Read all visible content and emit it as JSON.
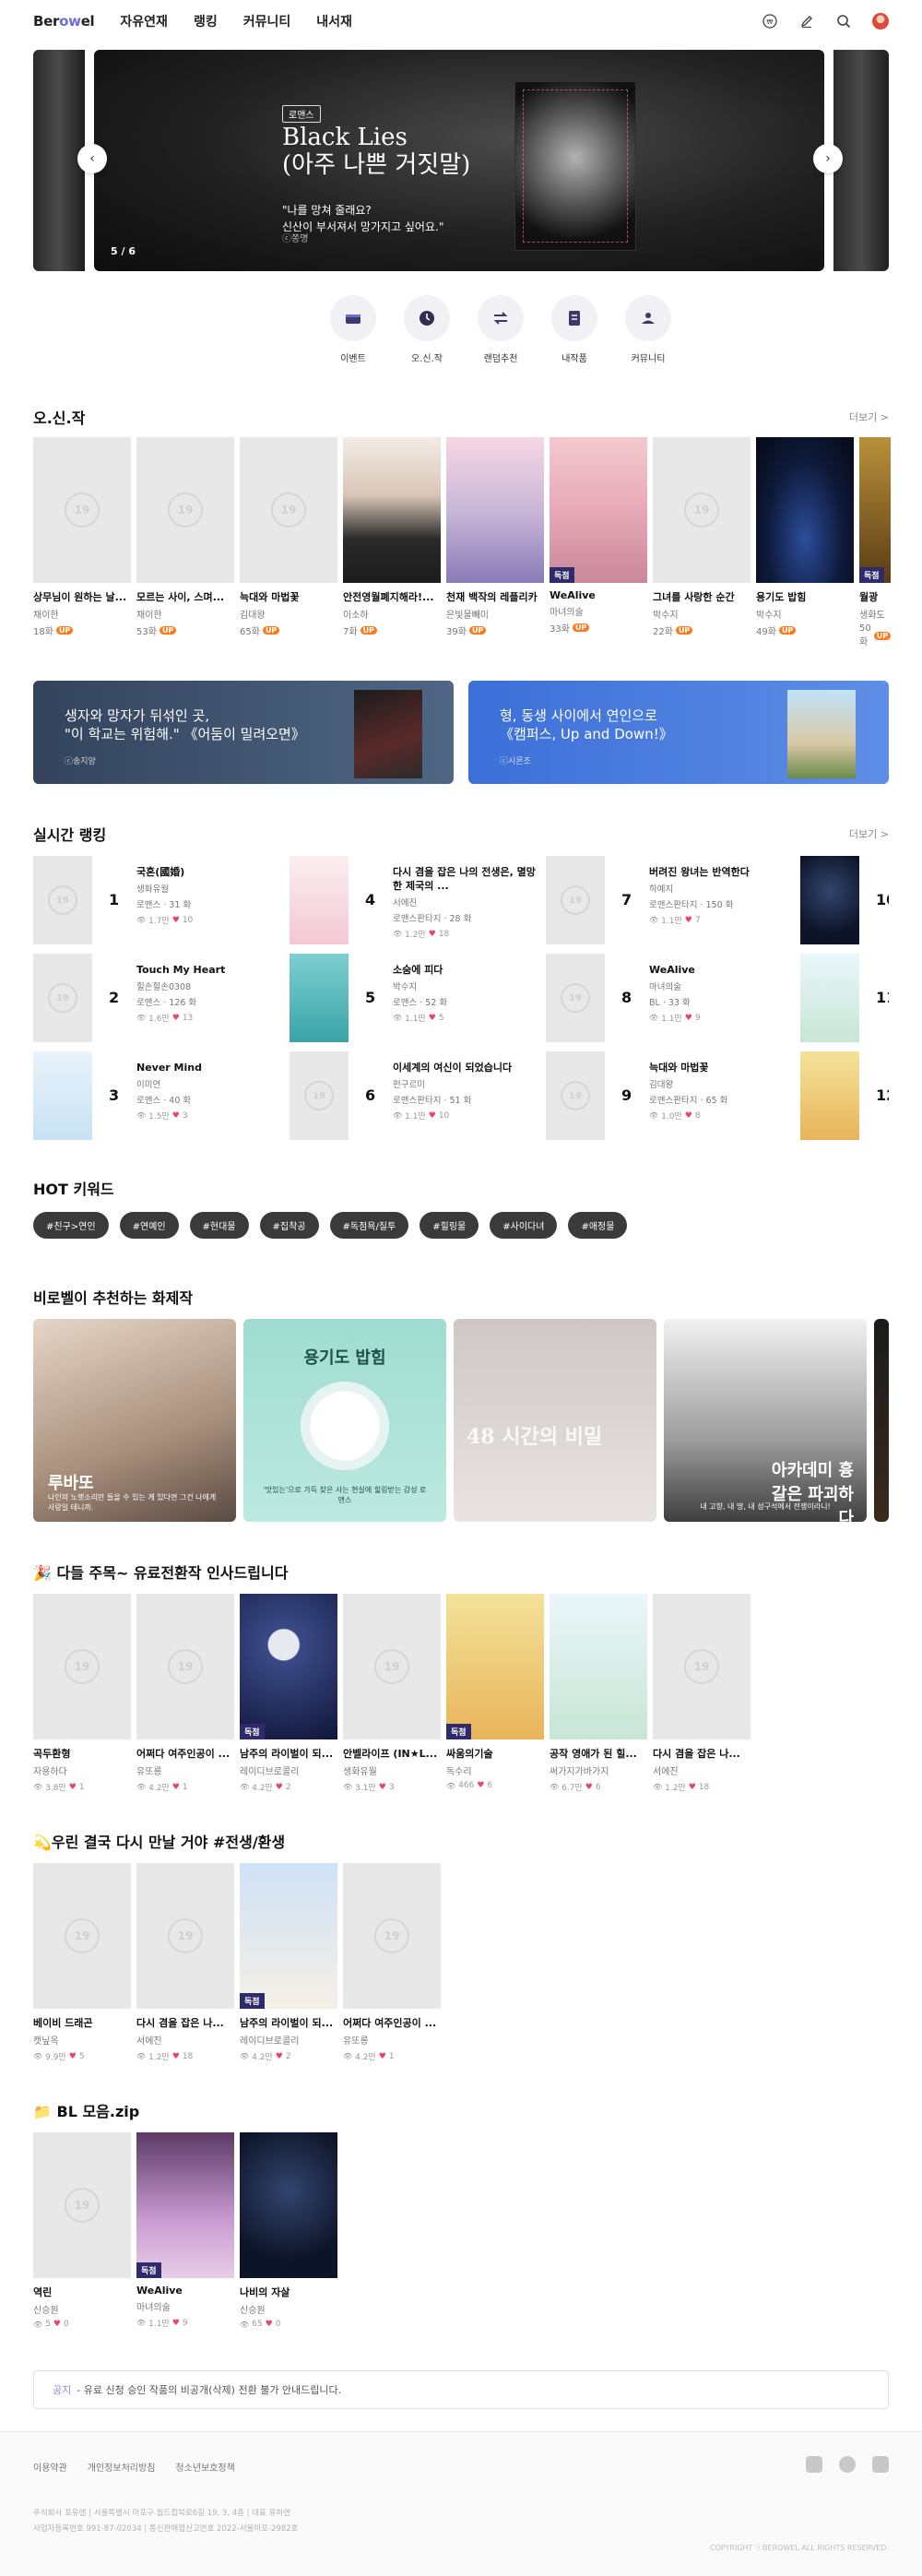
{
  "header": {
    "logo_text": "Berowel",
    "nav": [
      "자유연재",
      "랭킹",
      "커뮤니티",
      "내서재"
    ],
    "icons": [
      "coin-icon",
      "pen-icon",
      "search-icon",
      "avatar"
    ]
  },
  "banner": {
    "tag": "로맨스",
    "title_line1": "Black Lies",
    "title_line2": "(아주 나쁜 거짓말)",
    "copy_line1": "\"나를 망쳐 줄래요?",
    "copy_line2": "신산이 부서져서 망가지고 싶어요.\"",
    "credit": "ⓒ쫑명",
    "page": "5 / 6"
  },
  "quick_menu": [
    {
      "label": "이벤트",
      "icon": "event-icon"
    },
    {
      "label": "오.신.작",
      "icon": "clock-icon"
    },
    {
      "label": "랜덤추천",
      "icon": "shuffle-icon"
    },
    {
      "label": "내작품",
      "icon": "my-works-icon"
    },
    {
      "label": "커뮤니티",
      "icon": "community-icon"
    }
  ],
  "new_works": {
    "title": "오.신.작",
    "more": "더보기 >",
    "items": [
      {
        "title": "상무님이 원하는 날...",
        "author": "채이한",
        "episodes": "18화",
        "cover": "age19"
      },
      {
        "title": "모르는 사이, 스며...",
        "author": "채이한",
        "episodes": "53화",
        "cover": "age19"
      },
      {
        "title": "늑대와 마법꽃",
        "author": "김대왕",
        "episodes": "65화",
        "cover": "age19"
      },
      {
        "title": "안전영월폐지해라!...",
        "author": "이소하",
        "episodes": "7화",
        "cover": "man"
      },
      {
        "title": "천재 백작의 레플리카",
        "author": "은빛물빼미",
        "episodes": "39화",
        "cover": "couple"
      },
      {
        "title": "WeAlive",
        "author": "마녀의술",
        "episodes": "33화",
        "cover": "pink",
        "badge": "독점"
      },
      {
        "title": "그녀를 사랑한 순간",
        "author": "박수지",
        "episodes": "22화",
        "cover": "age19"
      },
      {
        "title": "용기도 밥힘",
        "author": "박수지",
        "episodes": "49화",
        "cover": "night"
      },
      {
        "title": "월광",
        "author": "생화도",
        "episodes": "50화",
        "cover": "gold",
        "badge": "독점"
      }
    ],
    "up_label": "UP"
  },
  "promos": [
    {
      "title_line1": "생자와 망자가 뒤섞인 곳,",
      "title_line2": "\"이 학교는 위험해.\" 《어둠이 밀려오면》",
      "credit": "ⓒ송지양"
    },
    {
      "title_line1": "형, 동생 사이에서 연인으로",
      "title_line2": "《캠퍼스, Up and Down!》",
      "credit": "ⓒ시몬조"
    }
  ],
  "ranking": {
    "title": "실시간 랭킹",
    "more": "더보기 >",
    "items": [
      {
        "rank": "1",
        "title": "국혼(國婚)",
        "author": "생화유월",
        "genre": "로맨스 · 31 화",
        "views": "1.7만",
        "likes": "10",
        "cover": "age19"
      },
      {
        "rank": "2",
        "title": "Touch My Heart",
        "author": "힐손힐손0308",
        "genre": "로맨스 · 126 화",
        "views": "1.6만",
        "likes": "13",
        "cover": "age19"
      },
      {
        "rank": "3",
        "title": "Never Mind",
        "author": "이미연",
        "genre": "로맨스 · 40 화",
        "views": "1.5만",
        "likes": "3",
        "cover": "lightblue"
      },
      {
        "rank": "4",
        "title": "다시 겸을 잡은 나의 전생은, 멸망한 제국의 ...",
        "author": "서에진",
        "genre": "로맨스판타지 · 28 화",
        "views": "1.2만",
        "likes": "18",
        "cover": "pinkwhite"
      },
      {
        "rank": "5",
        "title": "소숨에 피다",
        "author": "박수지",
        "genre": "로맨스 · 52 화",
        "views": "1.1만",
        "likes": "5",
        "cover": "teal"
      },
      {
        "rank": "6",
        "title": "이세계의 여신이 되었습니다",
        "author": "펀구르미",
        "genre": "로맨스판타지 · 51 화",
        "views": "1.1만",
        "likes": "10",
        "cover": "age19"
      },
      {
        "rank": "7",
        "title": "버려진 왕녀는 반역한다",
        "author": "하예지",
        "genre": "로맨스판타지 · 150 화",
        "views": "1.1만",
        "likes": "7",
        "cover": "age19"
      },
      {
        "rank": "8",
        "title": "WeAlive",
        "author": "마녀의술",
        "genre": "BL · 33 화",
        "views": "1.1만",
        "likes": "9",
        "cover": "age19"
      },
      {
        "rank": "9",
        "title": "늑대와 마법꽃",
        "author": "김대왕",
        "genre": "로맨스판타지 · 65 화",
        "views": "1.0만",
        "likes": "8",
        "cover": "age19"
      }
    ],
    "peek_numbers": [
      "10",
      "11",
      "12"
    ]
  },
  "hot_keywords": {
    "title": "HOT 키워드",
    "items": [
      "#친구>연인",
      "#연예인",
      "#현대물",
      "#집착공",
      "#독점욕/질투",
      "#힐링물",
      "#사이다녀",
      "#애정물"
    ]
  },
  "featured": {
    "title": "비로벨이 추천하는 화제작",
    "items": [
      {
        "name": "루바또",
        "sub": "나인의 노랫소리만 들을 수 있는 게 있다면 그건 나에게 사랑일 테니까.",
        "style": "man-portrait"
      },
      {
        "name": "용기도 밥힘",
        "sub": "'맛있는'으로 가득 찾은 사는 현실에 힐링받는 감성 로맨스",
        "style": "plate"
      },
      {
        "name": "48 시간의 비밀",
        "sub": "",
        "style": "woman"
      },
      {
        "name": "아카데미 흉갈은 파괴하다",
        "sub": "내 고향, 내 땅, 내 성구석에서 전쟁이라니!",
        "style": "castle"
      }
    ]
  },
  "paid": {
    "title": "🎉 다들 주목~ 유료전환작 인사드립니다",
    "items": [
      {
        "title": "곡두환형",
        "author": "자용하다",
        "views": "3.8만",
        "likes": "1",
        "cover": "age19"
      },
      {
        "title": "어쩌다 여주인공이 ...",
        "author": "유또롱",
        "views": "4.2만",
        "likes": "1",
        "cover": "age19"
      },
      {
        "title": "남주의 라이벌이 되...",
        "author": "레이디브로콜리",
        "views": "4.2만",
        "likes": "2",
        "cover": "moon",
        "badge": "독점"
      },
      {
        "title": "안벨라이프 (IN★L...",
        "author": "생화유월",
        "views": "3.1만",
        "likes": "3",
        "cover": "age19"
      },
      {
        "title": "싸움의기술",
        "author": "독수리",
        "views": "466",
        "likes": "6",
        "cover": "yellow",
        "badge": "독점"
      },
      {
        "title": "공작 영애가 된 힐...",
        "author": "써가지가바가지",
        "views": "6.7만",
        "likes": "6",
        "cover": "sky"
      },
      {
        "title": "다시 겸을 잡은 나...",
        "author": "서에진",
        "views": "1.2만",
        "likes": "18",
        "cover": "age19"
      }
    ]
  },
  "reincarnation": {
    "title": "💫우린 결국 다시 만날 거야 #전생/환생",
    "items": [
      {
        "title": "베이비 드래곤",
        "author": "캣닢옥",
        "views": "9.9만",
        "likes": "5",
        "cover": "age19"
      },
      {
        "title": "다시 겸을 잡은 나...",
        "author": "서에진",
        "views": "1.2만",
        "likes": "18",
        "cover": "age19"
      },
      {
        "title": "남주의 라이벌이 되...",
        "author": "레이디브로콜리",
        "views": "4.2만",
        "likes": "2",
        "cover": "gukhon",
        "badge": "독점"
      },
      {
        "title": "어쩌다 여주인공이 ...",
        "author": "유또롱",
        "views": "4.2만",
        "likes": "1",
        "cover": "age19"
      }
    ]
  },
  "bl": {
    "title": "📁 BL 모음.zip",
    "items": [
      {
        "title": "역린",
        "author": "신승원",
        "views": "5",
        "likes": "0",
        "cover": "age19"
      },
      {
        "title": "WeAlive",
        "author": "마녀의술",
        "views": "1.1만",
        "likes": "9",
        "cover": "anime",
        "badge": "독점"
      },
      {
        "title": "나비의 자살",
        "author": "신승원",
        "views": "65",
        "likes": "0",
        "cover": "darkblue"
      }
    ]
  },
  "notice": {
    "label": "공지",
    "text": "- 유료 신청 승인 작품의 비공개(삭제) 전환 불가 안내드립니다."
  },
  "footer": {
    "links": [
      "이용약관",
      "개인정보처리방침",
      "청소년보호정책"
    ],
    "social": [
      "chat-icon",
      "twitter-icon",
      "instagram-icon"
    ],
    "company_line1": "주식회사 포유엠 | 서울특별시 마포구 월드컵북로6길 19, 3, 4층 | 대표 유하연",
    "company_line2": "사업자등록번호 991-87-02034 | 통신판매업신고번호 2022-서울마포-2982호",
    "copyright": "COPYRIGHT ⓒBEROWEL ALL RIGHTS RESERVED."
  },
  "age_label": "19",
  "colors": {
    "accent": "#6f6cd6",
    "up": "#ff7a1a",
    "heart": "#e8466f",
    "badge": "#2f2a6b"
  }
}
